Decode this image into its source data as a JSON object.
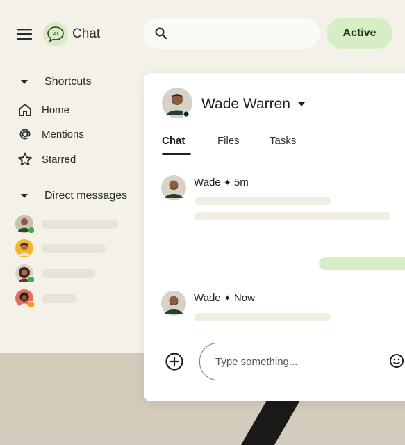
{
  "app": {
    "name": "Chat",
    "logo_badge": "AI"
  },
  "search": {
    "value": "",
    "placeholder": ""
  },
  "status": {
    "label": "Active"
  },
  "sidebar": {
    "shortcuts_label": "Shortcuts",
    "items": [
      {
        "label": "Home",
        "icon": "home-icon"
      },
      {
        "label": "Mentions",
        "icon": "at-sign-icon"
      },
      {
        "label": "Starred",
        "icon": "star-icon"
      }
    ],
    "direct_messages_label": "Direct messages",
    "dms": [
      {
        "avatar_color": "#6f8a6a",
        "presence": "#3cb043"
      },
      {
        "avatar_color": "#f3b52d",
        "presence": ""
      },
      {
        "avatar_color": "#a0826d",
        "presence": "#3cb043"
      },
      {
        "avatar_color": "#e56d5d",
        "presence": "#f39a1e"
      }
    ]
  },
  "conversation": {
    "contact_name": "Wade Warren",
    "tabs": [
      "Chat",
      "Files",
      "Tasks"
    ],
    "active_tab": "Chat",
    "messages": [
      {
        "sender": "Wade",
        "separator": "✦",
        "time": "5m"
      },
      {
        "sender": "Wade",
        "separator": "✦",
        "time": "Now"
      }
    ]
  },
  "composer": {
    "placeholder": "Type something...",
    "value": ""
  },
  "colors": {
    "accent_green": "#d6edc6",
    "background": "#f4f1e8",
    "presence_online": "#3cb043",
    "presence_away": "#f39a1e"
  }
}
